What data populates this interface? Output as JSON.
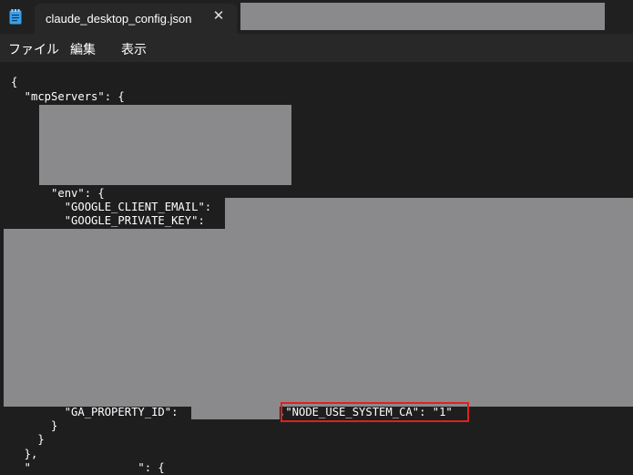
{
  "window": {
    "tab_title": "claude_desktop_config.json",
    "close_glyph": "✕",
    "app_icon": "notepad-icon"
  },
  "menu": {
    "items": [
      "ファイル",
      "編集",
      "表示"
    ]
  },
  "editor": {
    "lines": [
      "{",
      "  \"mcpServers\": {",
      "      \"env\": {",
      "        \"GOOGLE_CLIENT_EMAIL\":",
      "        \"GOOGLE_PRIVATE_KEY\":",
      "        \"GA_PROPERTY_ID\":",
      ",\"NODE_USE_SYSTEM_CA\": \"1\"",
      "      }",
      "    }",
      "  },",
      "  \"                \": {"
    ]
  },
  "colors": {
    "background": "#1e1e1e",
    "redaction": "#8a8a8c",
    "highlight": "#e02020",
    "text": "#ffffff"
  }
}
